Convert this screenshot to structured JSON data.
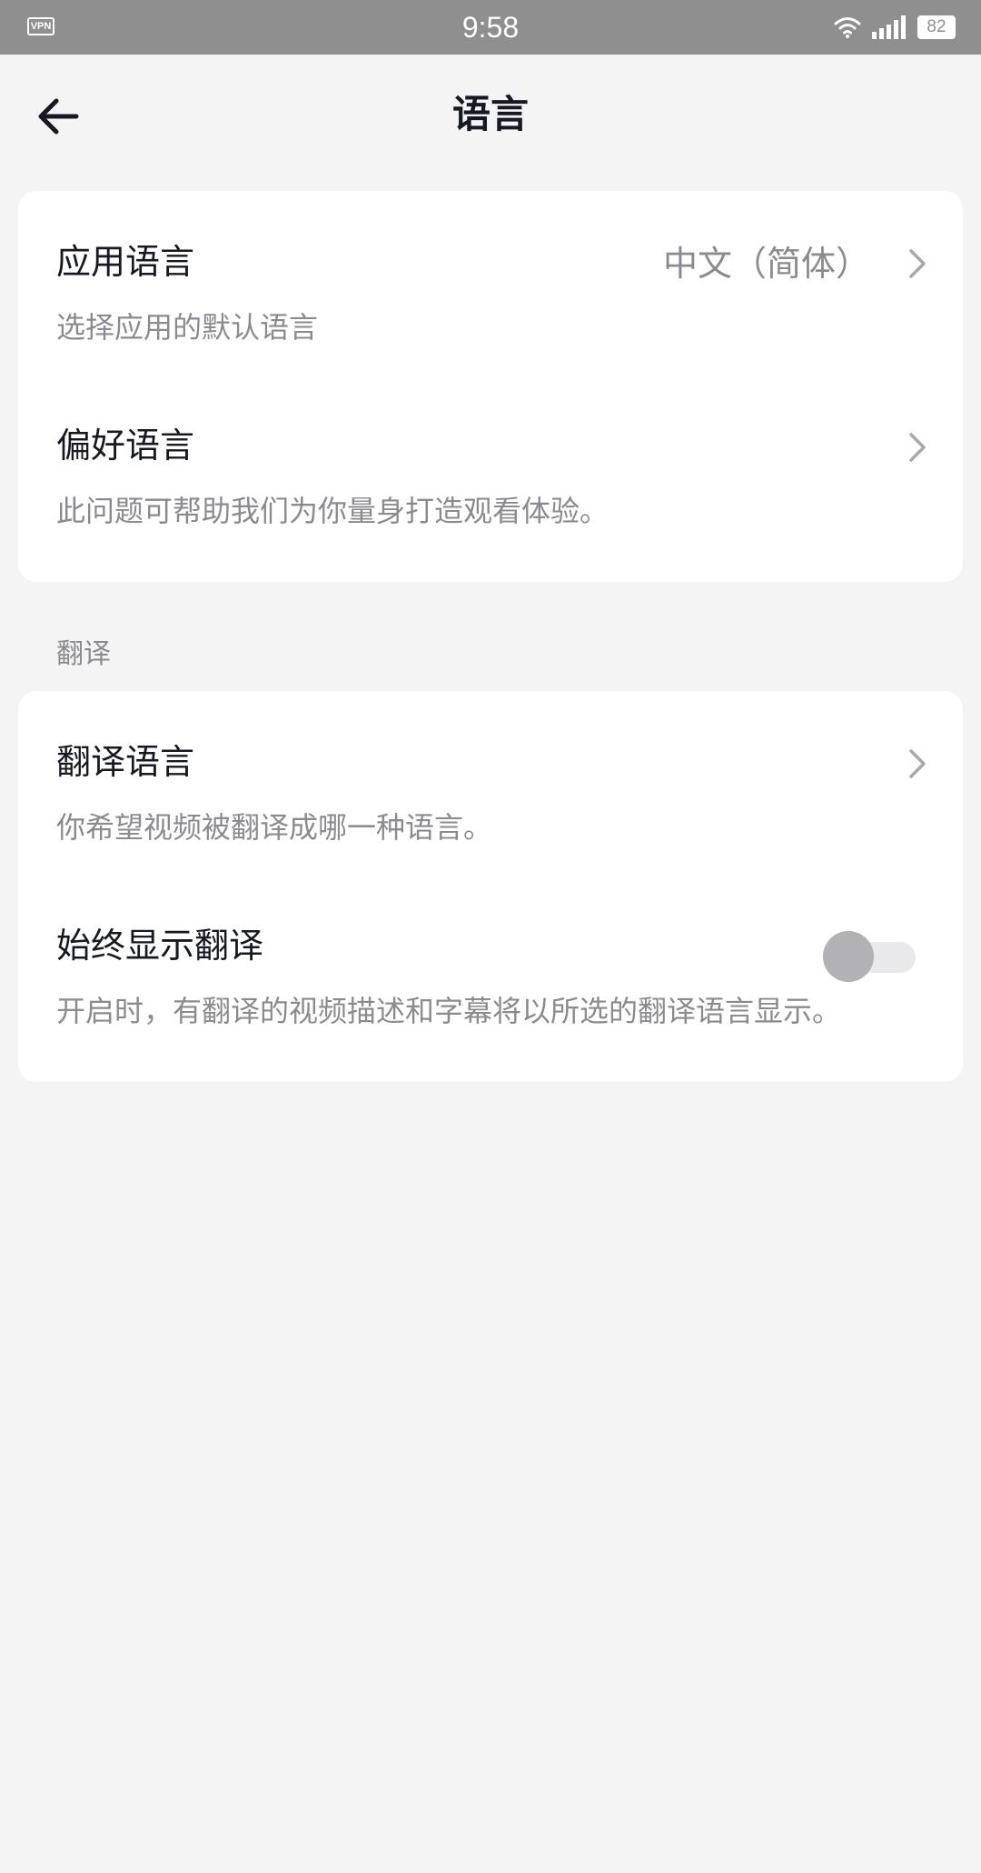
{
  "status_bar": {
    "vpn_label": "VPN",
    "time": "9:58",
    "battery_level": "82"
  },
  "header": {
    "title": "语言"
  },
  "language_card": {
    "app_language": {
      "title": "应用语言",
      "description": "选择应用的默认语言",
      "value": "中文（简体）"
    },
    "preferred_language": {
      "title": "偏好语言",
      "description": "此问题可帮助我们为你量身打造观看体验。"
    }
  },
  "translation_section": {
    "label": "翻译",
    "translation_language": {
      "title": "翻译语言",
      "description": "你希望视频被翻译成哪一种语言。"
    },
    "always_show_translation": {
      "title": "始终显示翻译",
      "description": "开启时，有翻译的视频描述和字幕将以所选的翻译语言显示。",
      "enabled": false
    }
  },
  "colors": {
    "background": "#f4f4f5",
    "card": "#ffffff",
    "primary_text": "#161823",
    "secondary_text": "#8a8b91",
    "status_bar": "#8f8f8f"
  }
}
